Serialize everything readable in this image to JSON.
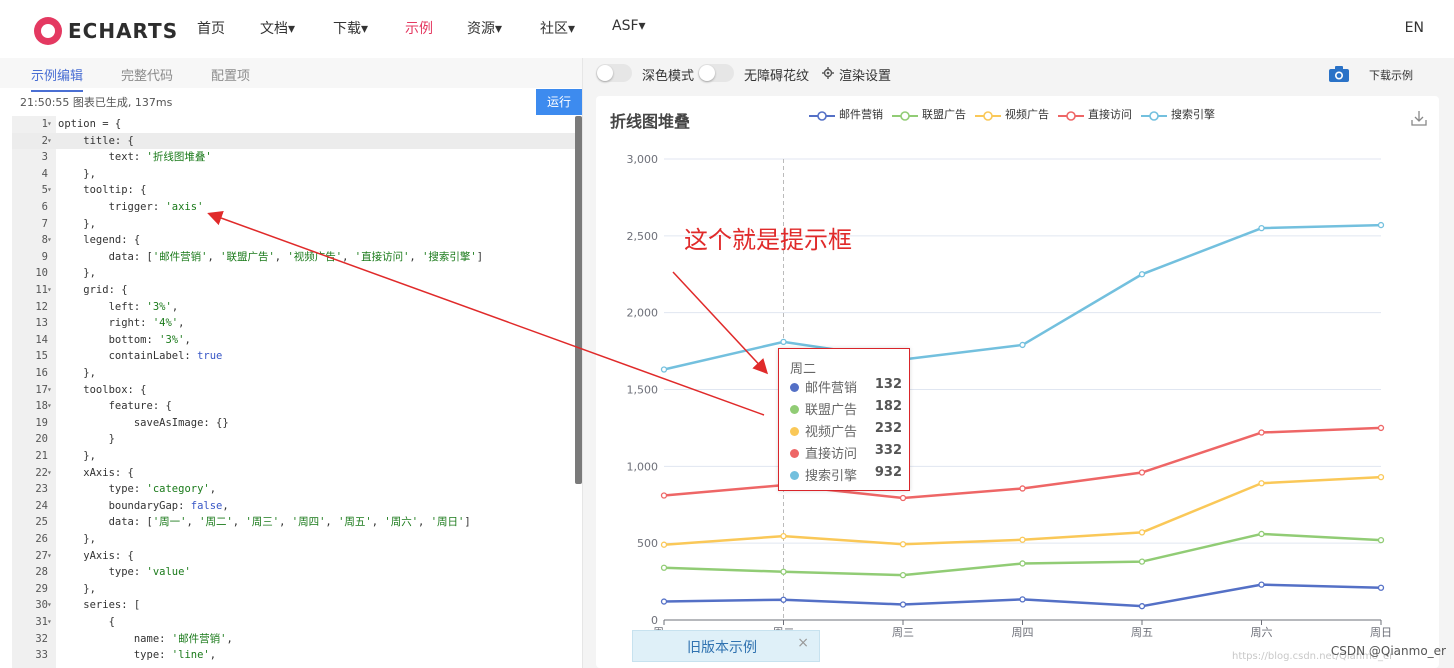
{
  "header": {
    "logo_text": "ECHARTS",
    "nav": [
      "首页",
      "文档▾",
      "下载▾",
      "示例",
      "资源▾",
      "社区▾",
      "ASF▾"
    ],
    "active_nav": "示例",
    "lang": "EN"
  },
  "editor": {
    "tabs": [
      "示例编辑",
      "完整代码",
      "配置项"
    ],
    "active_tab": "示例编辑",
    "status": "21:50:55   图表已生成, 137ms",
    "run_label": "运行",
    "code_lines": [
      "option = {",
      "    title: {",
      "        text: '折线图堆叠'",
      "    },",
      "    tooltip: {",
      "        trigger: 'axis'",
      "    },",
      "    legend: {",
      "        data: ['邮件营销', '联盟广告', '视频广告', '直接访问', '搜索引擎']",
      "    },",
      "    grid: {",
      "        left: '3%',",
      "        right: '4%',",
      "        bottom: '3%',",
      "        containLabel: true",
      "    },",
      "    toolbox: {",
      "        feature: {",
      "            saveAsImage: {}",
      "        }",
      "    },",
      "    xAxis: {",
      "        type: 'category',",
      "        boundaryGap: false,",
      "        data: ['周一', '周二', '周三', '周四', '周五', '周六', '周日']",
      "    },",
      "    yAxis: {",
      "        type: 'value'",
      "    },",
      "    series: [",
      "        {",
      "            name: '邮件营销',",
      "            type: 'line',"
    ],
    "fold_lines": [
      1,
      2,
      5,
      8,
      11,
      17,
      18,
      22,
      27,
      30,
      31
    ]
  },
  "preview": {
    "dark_mode_label": "深色模式",
    "a11y_label": "无障碍花纹",
    "render_settings_label": "渲染设置",
    "download_example_label": "下载示例",
    "annotation": "这个就是提示框",
    "old_example_label": "旧版本示例",
    "old_example_close": "×",
    "watermark": "CSDN @Qianmo_er",
    "watermark_faint": "https://blog.csdn.net/Qianmo_er"
  },
  "chart_data": {
    "type": "line",
    "title": "折线图堆叠",
    "categories": [
      "周一",
      "周二",
      "周三",
      "周四",
      "周五",
      "周六",
      "周日"
    ],
    "ylim": [
      0,
      3000
    ],
    "yticks": [
      0,
      500,
      1000,
      1500,
      2000,
      2500,
      3000
    ],
    "ytick_labels": [
      "0",
      "500",
      "1,000",
      "1,500",
      "2,000",
      "2,500",
      "3,000"
    ],
    "grid": true,
    "legend_position": "top",
    "series": [
      {
        "name": "邮件营销",
        "color": "#5470c6",
        "values": [
          120,
          132,
          101,
          134,
          90,
          230,
          210
        ]
      },
      {
        "name": "联盟广告",
        "color": "#91cc75",
        "values": [
          220,
          182,
          191,
          234,
          290,
          330,
          310
        ]
      },
      {
        "name": "视频广告",
        "color": "#fac858",
        "values": [
          150,
          232,
          201,
          154,
          190,
          330,
          410
        ]
      },
      {
        "name": "直接访问",
        "color": "#ee6666",
        "values": [
          320,
          332,
          301,
          334,
          390,
          330,
          320
        ]
      },
      {
        "name": "搜索引擎",
        "color": "#73c0de",
        "values": [
          820,
          932,
          901,
          934,
          1290,
          1330,
          1320
        ]
      }
    ],
    "stacked": true,
    "tooltip": {
      "title": "周二",
      "rows": [
        {
          "name": "邮件营销",
          "value": "132"
        },
        {
          "name": "联盟广告",
          "value": "182"
        },
        {
          "name": "视频广告",
          "value": "232"
        },
        {
          "name": "直接访问",
          "value": "332"
        },
        {
          "name": "搜索引擎",
          "value": "932"
        }
      ]
    }
  }
}
